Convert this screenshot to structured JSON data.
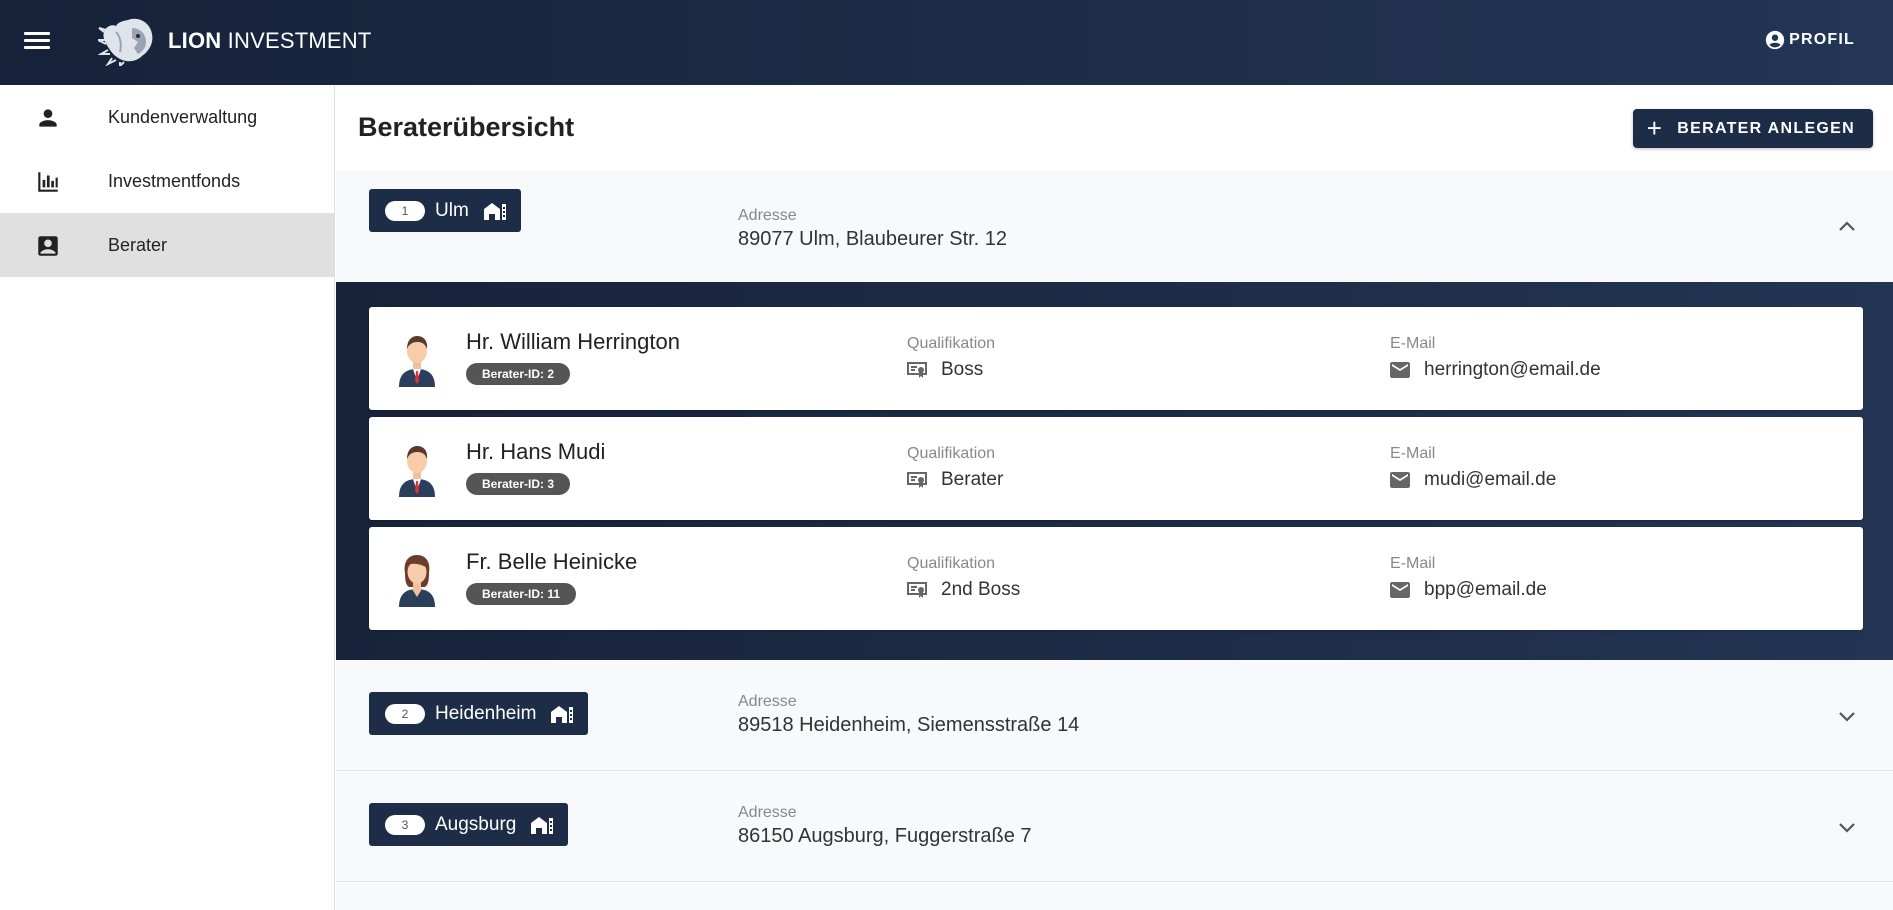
{
  "header": {
    "brand_bold": "LION",
    "brand_rest": " INVESTMENT",
    "profile_label": "PROFIL"
  },
  "sidebar": {
    "items": [
      {
        "label": "Kundenverwaltung",
        "icon": "person-icon"
      },
      {
        "label": "Investmentfonds",
        "icon": "bar-chart-icon"
      },
      {
        "label": "Berater",
        "icon": "contact-card-icon",
        "active": true
      }
    ]
  },
  "main": {
    "title": "Beraterübersicht",
    "add_button_label": "BERATER ANLEGEN",
    "branches": [
      {
        "number": "1",
        "name": "Ulm",
        "address_label": "Adresse",
        "address": "89077 Ulm, Blaubeurer Str. 12",
        "expanded": true,
        "advisors": [
          {
            "name": "Hr. William Herrington",
            "badge": "Berater-ID: 2",
            "qual_label": "Qualifikation",
            "qualification": "Boss",
            "email_label": "E-Mail",
            "email": "herrington@email.de",
            "gender": "male"
          },
          {
            "name": "Hr. Hans Mudi",
            "badge": "Berater-ID: 3",
            "qual_label": "Qualifikation",
            "qualification": "Berater",
            "email_label": "E-Mail",
            "email": "mudi@email.de",
            "gender": "male"
          },
          {
            "name": "Fr. Belle Heinicke",
            "badge": "Berater-ID: 11",
            "qual_label": "Qualifikation",
            "qualification": "2nd Boss",
            "email_label": "E-Mail",
            "email": "bpp@email.de",
            "gender": "female"
          }
        ]
      },
      {
        "number": "2",
        "name": "Heidenheim",
        "address_label": "Adresse",
        "address": "89518 Heidenheim, Siemensstraße 14",
        "expanded": false
      },
      {
        "number": "3",
        "name": "Augsburg",
        "address_label": "Adresse",
        "address": "86150 Augsburg, Fuggerstraße 7",
        "expanded": false
      }
    ]
  },
  "colors": {
    "navy": "#1d2c47",
    "active_sidebar": "#e0e0e0",
    "badge_gray": "#555555"
  }
}
